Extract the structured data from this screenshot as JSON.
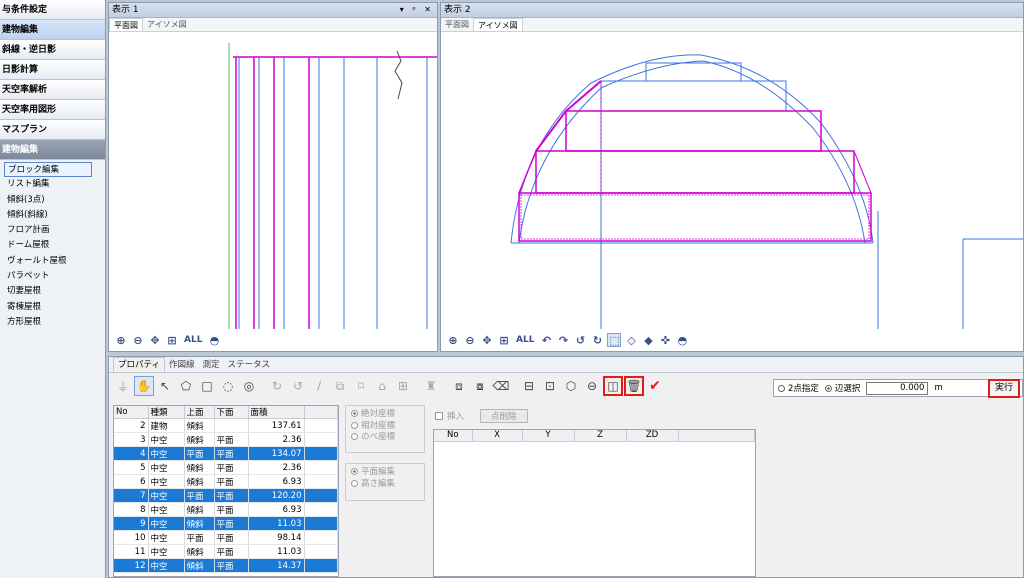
{
  "sidebar": {
    "items": [
      "与条件設定",
      "建物編集",
      "斜線・逆日影",
      "日影計算",
      "天空率解析",
      "天空率用図形",
      "マスプラン"
    ],
    "section": "建物編集",
    "subitems": [
      "ブロック編集",
      "リスト編集",
      "傾斜(3点)",
      "傾斜(斜線)",
      "フロア計画",
      "ドーム屋根",
      "ヴォールト屋根",
      "パラペット",
      "切妻屋根",
      "寄棟屋根",
      "方形屋根"
    ]
  },
  "view1": {
    "title": "表示 1",
    "window_controls": "▾ ᵖ ✕",
    "tabs": [
      "平面図",
      "アイソメ図"
    ]
  },
  "view2": {
    "title": "表示 2",
    "tabs": [
      "平面図",
      "アイソメ図"
    ]
  },
  "view_toolbar": {
    "all_label": "ALL"
  },
  "bottom": {
    "tabs": [
      "プロパティ",
      "作図線",
      "測定",
      "ステータス"
    ],
    "table": {
      "headers": [
        "No",
        "種類",
        "上面",
        "下面",
        "面積"
      ],
      "rows": [
        {
          "no": "2",
          "kind": "建物",
          "top": "傾斜",
          "bottom": "",
          "area": "137.61",
          "sel": false
        },
        {
          "no": "3",
          "kind": "中空",
          "top": "傾斜",
          "bottom": "平面",
          "area": "2.36",
          "sel": false
        },
        {
          "no": "4",
          "kind": "中空",
          "top": "平面",
          "bottom": "平面",
          "area": "134.07",
          "sel": true
        },
        {
          "no": "5",
          "kind": "中空",
          "top": "傾斜",
          "bottom": "平面",
          "area": "2.36",
          "sel": false
        },
        {
          "no": "6",
          "kind": "中空",
          "top": "傾斜",
          "bottom": "平面",
          "area": "6.93",
          "sel": false
        },
        {
          "no": "7",
          "kind": "中空",
          "top": "平面",
          "bottom": "平面",
          "area": "120.20",
          "sel": true
        },
        {
          "no": "8",
          "kind": "中空",
          "top": "傾斜",
          "bottom": "平面",
          "area": "6.93",
          "sel": false
        },
        {
          "no": "9",
          "kind": "中空",
          "top": "傾斜",
          "bottom": "平面",
          "area": "11.03",
          "sel": true
        },
        {
          "no": "10",
          "kind": "中空",
          "top": "平面",
          "bottom": "平面",
          "area": "98.14",
          "sel": false
        },
        {
          "no": "11",
          "kind": "中空",
          "top": "傾斜",
          "bottom": "平面",
          "area": "11.03",
          "sel": false
        },
        {
          "no": "12",
          "kind": "中空",
          "top": "傾斜",
          "bottom": "平面",
          "area": "14.37",
          "sel": true
        }
      ]
    },
    "coord_options": [
      "絶対座標",
      "相対座標",
      "のべ座標"
    ],
    "edit_options": [
      "平面編集",
      "高さ編集"
    ],
    "insert_label": "挿入",
    "delete_point_label": "点削除",
    "point_headers": [
      "No",
      "X",
      "Y",
      "Z",
      "ZD"
    ],
    "two_point_label": "2点指定",
    "edge_select_label": "辺選択",
    "value": "0.000",
    "unit": "m",
    "run_label": "実行"
  },
  "colors": {
    "selection": "#1b7ad6",
    "highlight": "#e21b1b",
    "magenta": "#d400d4",
    "blue": "#3b74e0"
  }
}
